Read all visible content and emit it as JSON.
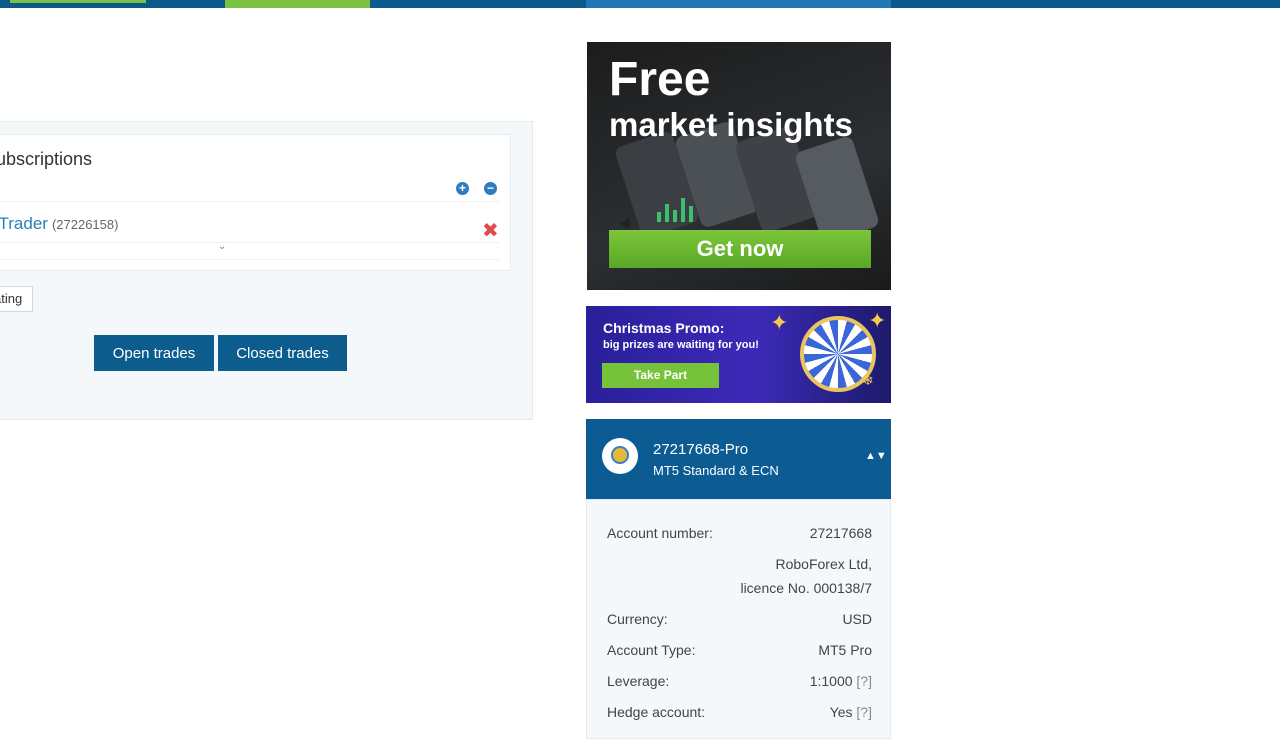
{
  "subscriptions": {
    "title": "ubscriptions",
    "plus_label": "+",
    "minus_label": "−",
    "item": {
      "name": "yTrader",
      "id": "(27226158)"
    },
    "remove_label": "✖",
    "expand_label": "⌄"
  },
  "rating_label": "ating",
  "buttons": {
    "open_trades": "Open trades",
    "closed_trades": "Closed trades"
  },
  "ad_insights": {
    "line1": "Free",
    "line2": "market insights",
    "cta": "Get now"
  },
  "ad_promo": {
    "title": "Christmas Promo:",
    "subtitle": "big prizes are waiting for you!",
    "cta": "Take Part"
  },
  "account": {
    "name": "27217668-Pro",
    "type": "MT5 Standard & ECN",
    "toggle": "▲▼",
    "rows": [
      {
        "key": "Account number:",
        "value": "27217668"
      },
      {
        "key": "",
        "value": "RoboForex Ltd,"
      },
      {
        "key": "",
        "value": "licence No. 000138/7"
      },
      {
        "key": "Currency:",
        "value": "USD"
      },
      {
        "key": "Account Type:",
        "value": "MT5 Pro"
      },
      {
        "key": "Leverage:",
        "value": "1:1000",
        "help": "[?]"
      },
      {
        "key": "Hedge account:",
        "value": "Yes",
        "help": "[?]"
      }
    ]
  },
  "colors": {
    "brand_blue": "#0c5c93",
    "accent_green": "#7cc242",
    "link_blue": "#2a7fb8",
    "remove_red": "#e24b4b"
  }
}
